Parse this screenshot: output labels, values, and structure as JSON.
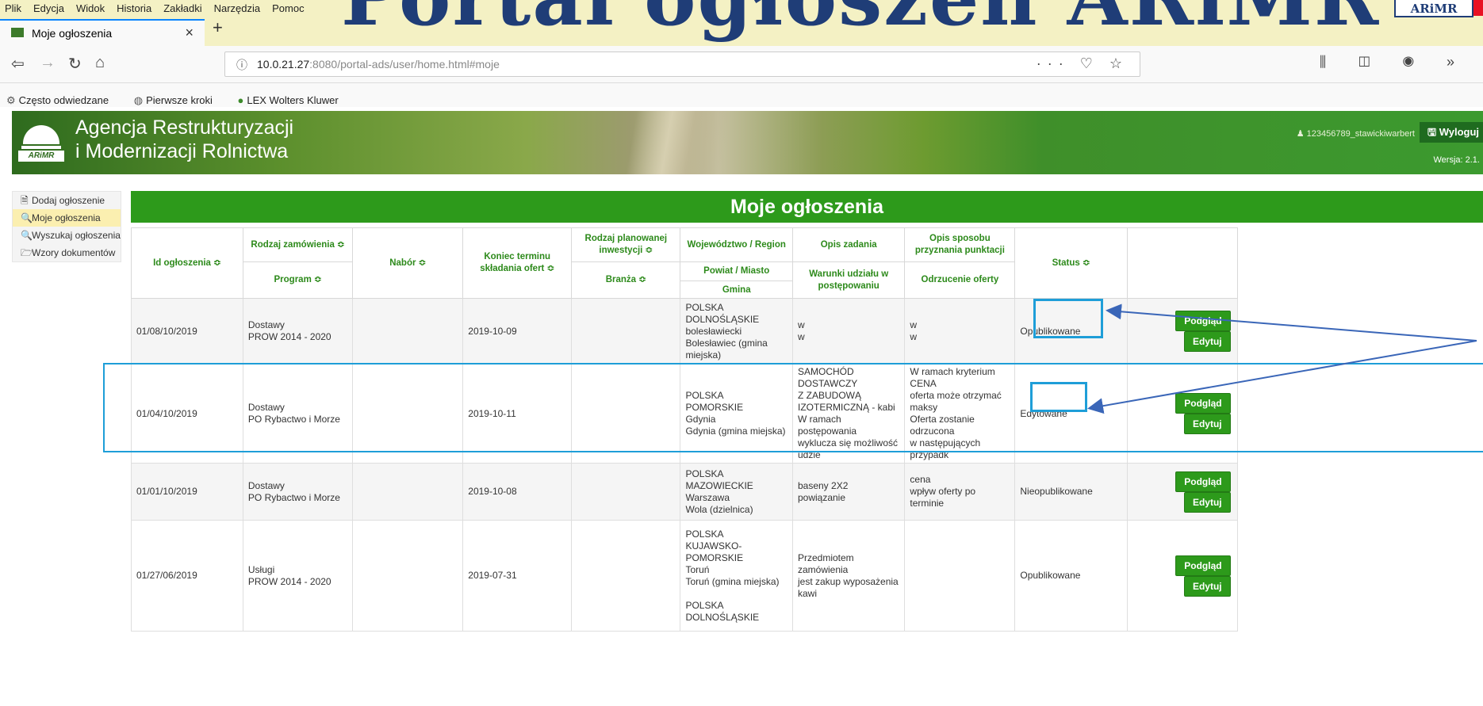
{
  "browser": {
    "menu": [
      "Plik",
      "Edycja",
      "Widok",
      "Historia",
      "Zakładki",
      "Narzędzia",
      "Pomoc"
    ],
    "tab_title": "Moje ogłoszenia",
    "new_tab": "+",
    "url_prefix": "10.0.21.27",
    "url_rest": ":8080/portal-ads/user/home.html#moje",
    "url_actions": "··· ♡ ☆",
    "toolbar_icons": "⫼ ◫ ◉ »",
    "bookmarks": [
      "Często odwiedzane",
      "Pierwsze kroki",
      "LEX Wolters Kluwer"
    ]
  },
  "overlay": {
    "title": "Portal ogłoszeń ARiMR",
    "badge": "ARiMR"
  },
  "header": {
    "agency_line1": "Agencja Restrukturyzacji",
    "agency_line2": "i Modernizacji Rolnictwa",
    "logo_text": "ARiMR",
    "user": "123456789_stawickiwarbert",
    "logout": "Wyloguj",
    "version": "Wersja: 2.1."
  },
  "sidebar": {
    "items": [
      {
        "label": "Dodaj ogłoszenie",
        "icon": "document-icon"
      },
      {
        "label": "Moje ogłoszenia",
        "icon": "search-icon"
      },
      {
        "label": "Wyszukaj ogłoszenia",
        "icon": "search-icon"
      },
      {
        "label": "Wzory dokumentów",
        "icon": "folder-icon"
      }
    ]
  },
  "main": {
    "title": "Moje ogłoszenia",
    "headers": {
      "id": "Id ogłoszenia ≎",
      "rodzaj": "Rodzaj zamówienia ≎",
      "program": "Program ≎",
      "nabor": "Nabór ≎",
      "koniec": "Koniec terminu składania ofert ≎",
      "inwestycja": "Rodzaj planowanej inwestycji ≎",
      "branza": "Branża ≎",
      "woj": "Województwo / Region",
      "powiat": "Powiat / Miasto",
      "gmina": "Gmina",
      "opis": "Opis zadania",
      "warunki": "Warunki udziału w postępowaniu",
      "punktacja": "Opis sposobu przyznania punktacji",
      "odrzucenie": "Odrzucenie oferty",
      "status": "Status ≎"
    },
    "rows": [
      {
        "id": "01/08/10/2019",
        "rodzaj": "Dostawy",
        "program": "PROW 2014 - 2020",
        "koniec": "2019-10-09",
        "lokalizacja": [
          "POLSKA",
          "DOLNOŚLĄSKIE",
          "bolesławiecki",
          "Bolesławiec (gmina",
          "miejska)"
        ],
        "opis": [
          "w",
          "w"
        ],
        "punktacja": [
          "w",
          "w"
        ],
        "status": "Opublikowane"
      },
      {
        "id": "01/04/10/2019",
        "rodzaj": "Dostawy",
        "program": "PO Rybactwo i Morze",
        "koniec": "2019-10-11",
        "lokalizacja": [
          "POLSKA",
          "POMORSKIE",
          "Gdynia",
          "Gdynia (gmina miejska)"
        ],
        "opis": [
          "SAMOCHÓD DOSTAWCZY",
          "Z ZABUDOWĄ",
          "IZOTERMICZNĄ - kabi",
          "W ramach postępowania",
          "wyklucza się możliwość",
          "udzie"
        ],
        "punktacja": [
          "W ramach kryterium CENA",
          "oferta może otrzymać",
          "maksy",
          "Oferta zostanie odrzucona",
          "w następujących przypadk"
        ],
        "status": "Edytowane"
      },
      {
        "id": "01/01/10/2019",
        "rodzaj": "Dostawy",
        "program": "PO Rybactwo i Morze",
        "koniec": "2019-10-08",
        "lokalizacja": [
          "POLSKA",
          "MAZOWIECKIE",
          "Warszawa",
          "Wola (dzielnica)"
        ],
        "opis": [
          "baseny 2X2",
          "powiązanie"
        ],
        "punktacja": [
          "cena",
          "wpływ oferty po terminie"
        ],
        "status": "Nieopublikowane"
      },
      {
        "id": "01/27/06/2019",
        "rodzaj": "Usługi",
        "program": "PROW 2014 - 2020",
        "koniec": "2019-07-31",
        "lokalizacja": [
          "POLSKA",
          "KUJAWSKO-POMORSKIE",
          "Toruń",
          "Toruń (gmina miejska)",
          "",
          "POLSKA",
          "DOLNOŚLĄSKIE"
        ],
        "opis": [
          "Przedmiotem zamówienia",
          "jest zakup wyposażenia",
          "kawi"
        ],
        "punktacja": [],
        "status": "Opublikowane"
      }
    ],
    "btn_preview": "Podgląd",
    "btn_edit": "Edytuj"
  },
  "colors": {
    "brand_green": "#2d9a1b",
    "annotation_blue": "#1e9ed8",
    "overlay_navy": "#1f3d77"
  }
}
